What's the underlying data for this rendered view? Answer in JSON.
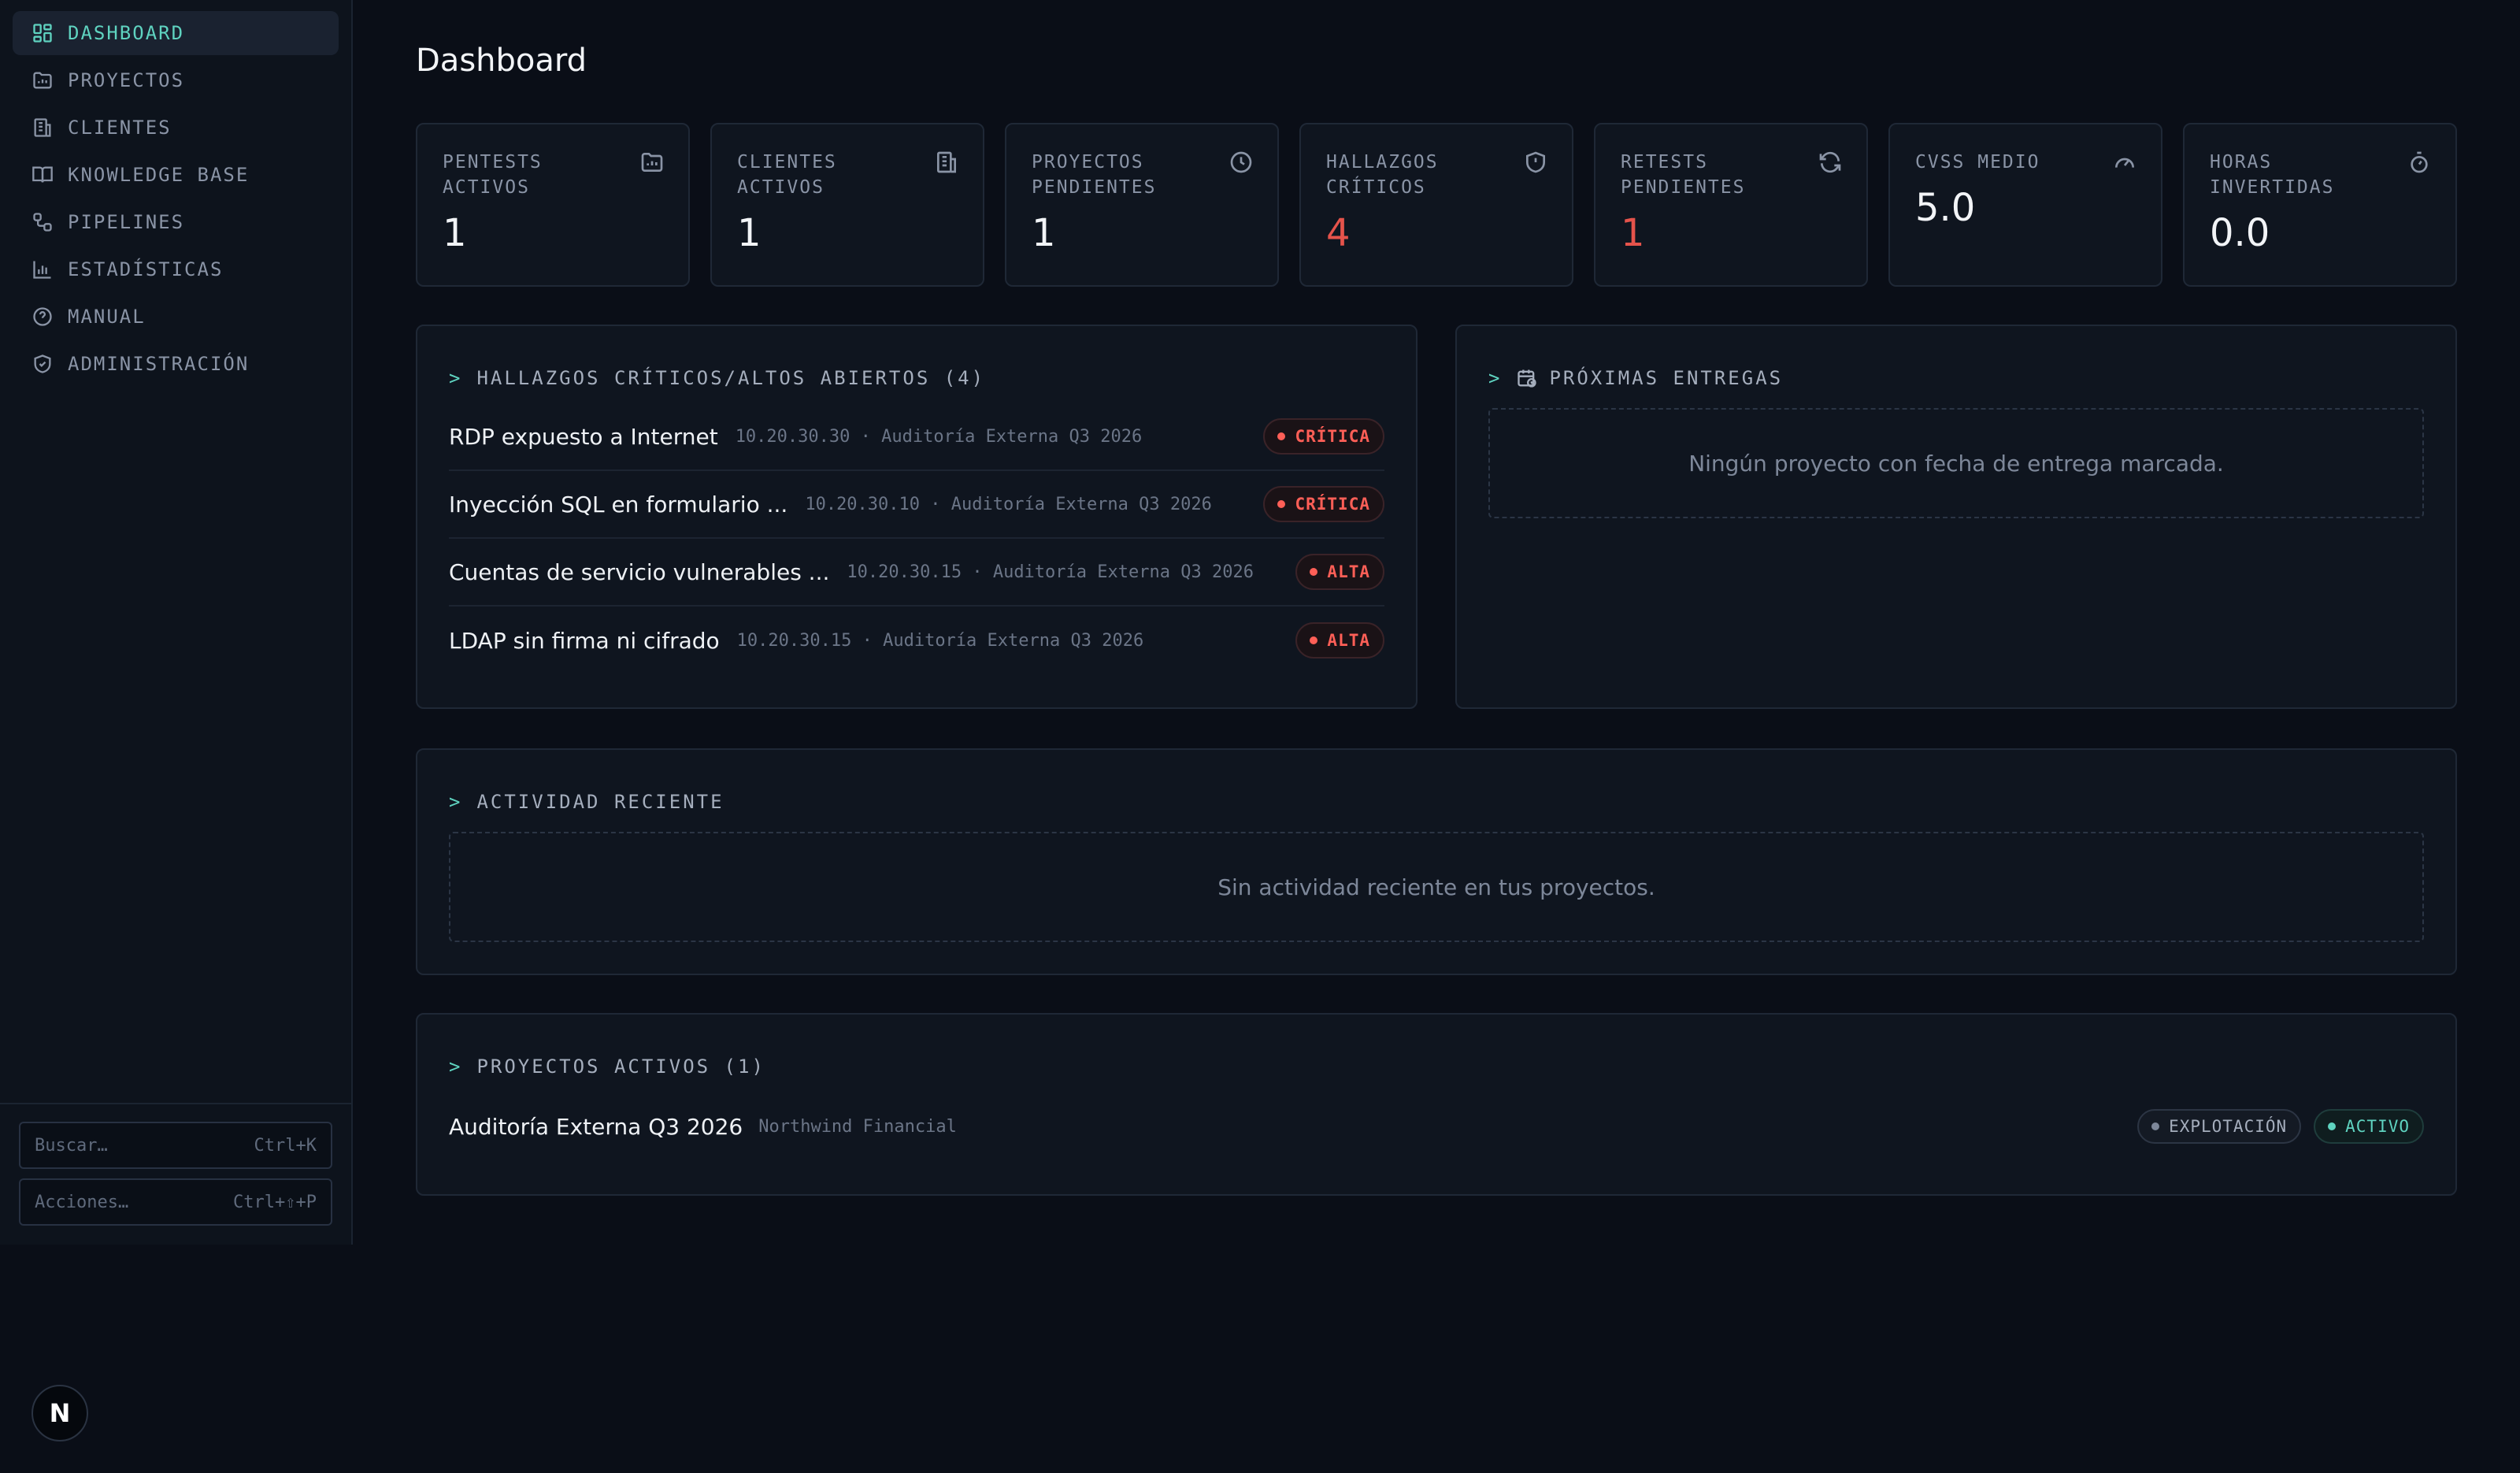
{
  "sidebar": {
    "items": [
      {
        "label": "DASHBOARD",
        "icon": "dashboard-icon",
        "active": true
      },
      {
        "label": "PROYECTOS",
        "icon": "folder-icon"
      },
      {
        "label": "CLIENTES",
        "icon": "building-icon"
      },
      {
        "label": "KNOWLEDGE BASE",
        "icon": "book-icon"
      },
      {
        "label": "PIPELINES",
        "icon": "workflow-icon"
      },
      {
        "label": "ESTADÍSTICAS",
        "icon": "bar-chart-icon"
      },
      {
        "label": "MANUAL",
        "icon": "help-circle-icon"
      },
      {
        "label": "ADMINISTRACIÓN",
        "icon": "shield-icon"
      }
    ],
    "search": {
      "placeholder": "Buscar…",
      "shortcut": "Ctrl+K"
    },
    "actions": {
      "placeholder": "Acciones…",
      "shortcut": "Ctrl+⇧+P"
    },
    "logo": "N"
  },
  "page": {
    "title": "Dashboard"
  },
  "stats": [
    {
      "label": "PENTESTS ACTIVOS",
      "value": "1",
      "icon": "folder-chart-icon"
    },
    {
      "label": "CLIENTES ACTIVOS",
      "value": "1",
      "icon": "building-icon"
    },
    {
      "label": "PROYECTOS PENDIENTES",
      "value": "1",
      "icon": "clock-icon"
    },
    {
      "label": "HALLAZGOS CRÍTICOS",
      "value": "4",
      "icon": "shield-alert-icon",
      "color": "#e5534b"
    },
    {
      "label": "RETESTS PENDIENTES",
      "value": "1",
      "icon": "refresh-icon",
      "color": "#e5534b"
    },
    {
      "label": "CVSS MEDIO",
      "value": "5.0",
      "icon": "gauge-icon"
    },
    {
      "label": "HORAS INVERTIDAS",
      "value": "0.0",
      "icon": "timer-icon"
    }
  ],
  "findings_panel": {
    "chevron": ">",
    "title": "HALLAZGOS CRÍTICOS/ALTOS ABIERTOS (4)",
    "items": [
      {
        "title": "RDP expuesto a Internet",
        "meta": "10.20.30.30 · Auditoría Externa Q3 2026",
        "severity": "CRÍTICA"
      },
      {
        "title": "Inyección SQL en formulario ...",
        "meta": "10.20.30.10 · Auditoría Externa Q3 2026",
        "severity": "CRÍTICA"
      },
      {
        "title": "Cuentas de servicio vulnerables ...",
        "meta": "10.20.30.15 · Auditoría Externa Q3 2026",
        "severity": "ALTA"
      },
      {
        "title": "LDAP sin firma ni cifrado",
        "meta": "10.20.30.15 · Auditoría Externa Q3 2026",
        "severity": "ALTA"
      }
    ]
  },
  "deliveries_panel": {
    "chevron": ">",
    "title": "PRÓXIMAS ENTREGAS",
    "empty": "Ningún proyecto con fecha de entrega marcada."
  },
  "activity_panel": {
    "chevron": ">",
    "title": "ACTIVIDAD RECIENTE",
    "empty": "Sin actividad reciente en tus proyectos."
  },
  "projects_panel": {
    "chevron": ">",
    "title": "PROYECTOS ACTIVOS (1)",
    "items": [
      {
        "name": "Auditoría Externa Q3 2026",
        "client": "Northwind Financial",
        "phase": "EXPLOTACIÓN",
        "status": "ACTIVO"
      }
    ]
  }
}
